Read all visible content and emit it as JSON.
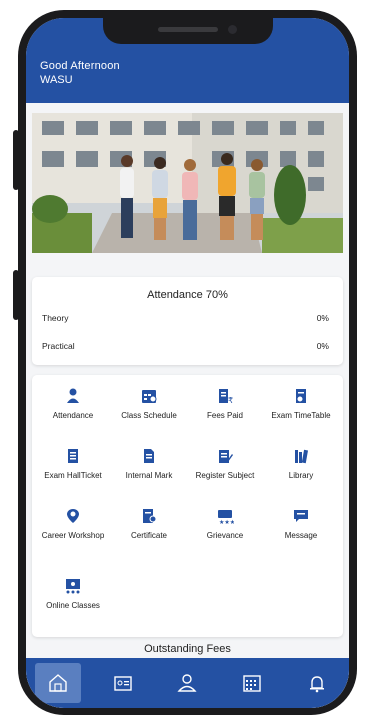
{
  "header": {
    "greeting": "Good Afternoon",
    "user_name": "WASU"
  },
  "hero": {
    "alt": "students-walking-photo"
  },
  "attendance": {
    "title": "Attendance 70%",
    "rows": [
      {
        "label": "Theory",
        "value": "0%"
      },
      {
        "label": "Practical",
        "value": "0%"
      }
    ]
  },
  "menu": {
    "items": [
      {
        "label": "Attendance",
        "icon": "attendance-icon"
      },
      {
        "label": "Class Schedule",
        "icon": "class-schedule-icon"
      },
      {
        "label": "Fees Paid",
        "icon": "fees-paid-icon"
      },
      {
        "label": "Exam TimeTable",
        "icon": "exam-timetable-icon"
      },
      {
        "label": "Exam HallTicket",
        "icon": "hall-ticket-icon"
      },
      {
        "label": "Internal Mark",
        "icon": "internal-mark-icon"
      },
      {
        "label": "Register Subject",
        "icon": "register-subject-icon"
      },
      {
        "label": "Library",
        "icon": "library-icon"
      },
      {
        "label": "Career Workshop",
        "icon": "career-workshop-icon"
      },
      {
        "label": "Certificate",
        "icon": "certificate-icon"
      },
      {
        "label": "Grievance",
        "icon": "grievance-icon"
      },
      {
        "label": "Message",
        "icon": "message-icon"
      },
      {
        "label": "Online Classes",
        "icon": "online-classes-icon"
      }
    ]
  },
  "outstanding": {
    "title": "Outstanding Fees"
  },
  "nav": {
    "items": [
      "home-icon",
      "id-card-icon",
      "profile-icon",
      "calendar-icon",
      "notification-icon"
    ]
  },
  "colors": {
    "primary": "#2451a3",
    "active_nav": "#5a7fc0",
    "background": "#f4f5f7"
  }
}
